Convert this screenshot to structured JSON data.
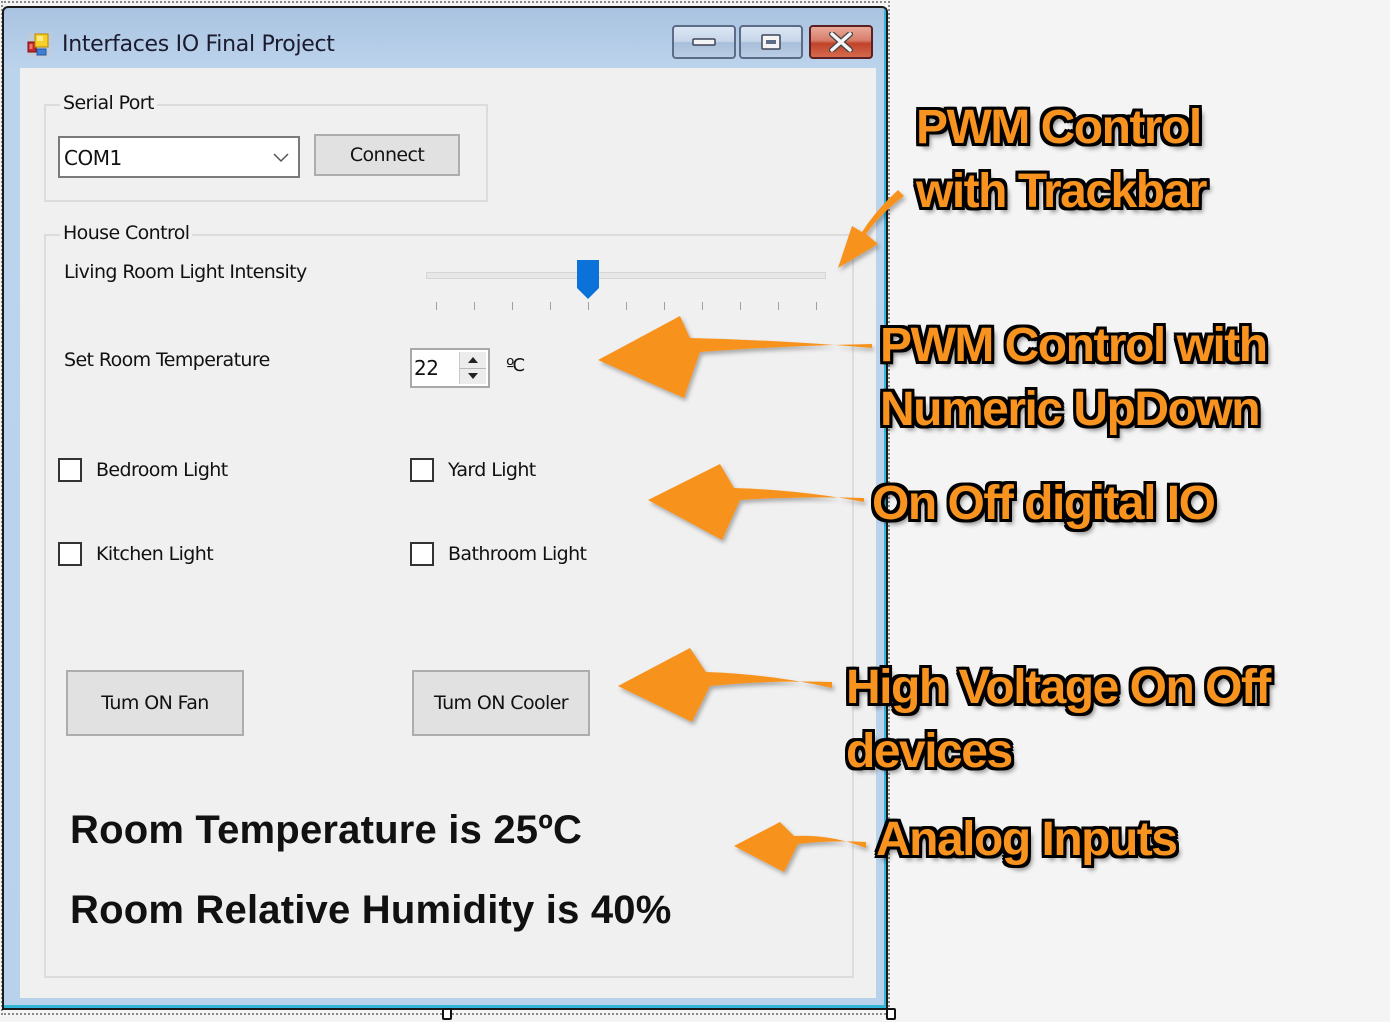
{
  "window": {
    "title": "Interfaces IO Final Project",
    "controls": {
      "minimize": "minimize",
      "maximize": "maximize",
      "close": "close"
    }
  },
  "serial_port": {
    "group_label": "Serial Port",
    "port_selected": "COM1",
    "connect_label": "Connect"
  },
  "house_control": {
    "group_label": "House Control",
    "light_intensity": {
      "label": "Living Room Light Intensity",
      "min": 0,
      "max": 10,
      "value": 4,
      "tick_count": 11
    },
    "temperature": {
      "label": "Set Room Temperature",
      "value": "22",
      "unit": "ºC"
    },
    "checkboxes": [
      {
        "label": "Bedroom Light",
        "checked": false
      },
      {
        "label": "Yard Light",
        "checked": false
      },
      {
        "label": "Kitchen Light",
        "checked": false
      },
      {
        "label": "Bathroom Light",
        "checked": false
      }
    ],
    "buttons": {
      "fan": "Tum ON Fan",
      "cooler": "Tum ON Cooler"
    },
    "readings": {
      "temperature": "Room Temperature is 25ºC",
      "humidity": "Room Relative Humidity is 40%"
    }
  },
  "annotations": {
    "trackbar": [
      "PWM Control",
      "with Trackbar"
    ],
    "numeric": [
      "PWM Control with",
      "Numeric UpDown"
    ],
    "digital": [
      "On Off digital IO"
    ],
    "high_voltage": [
      "High Voltage On Off",
      "devices"
    ],
    "analog": [
      "Analog Inputs"
    ],
    "color": "#f7931e"
  },
  "colors": {
    "thumb": "#0a72d8",
    "client_bg": "#f0f0f0",
    "close_button": "#c0432a"
  }
}
